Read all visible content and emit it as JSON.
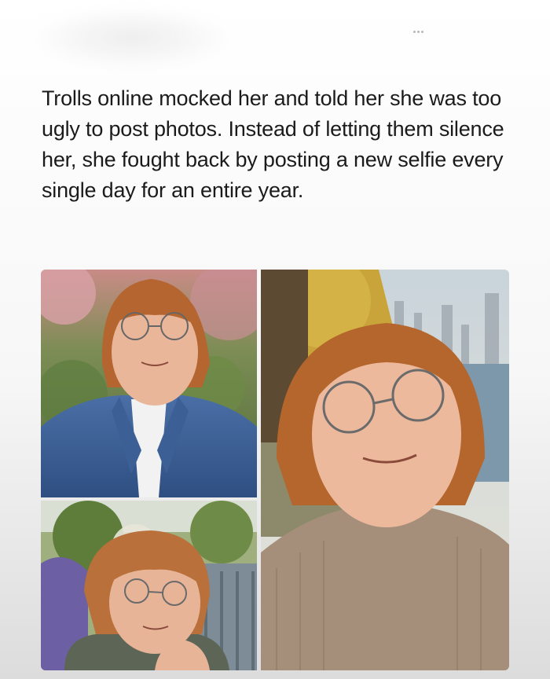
{
  "post": {
    "text": "Trolls online mocked her and told her she was too ugly to post photos. Instead of letting them silence her, she fought back by posting a new selfie every single day for an entire year."
  },
  "photos": [
    {
      "icon": "photo-selfie-denim-jacket-park"
    },
    {
      "icon": "photo-selfie-garden-fence"
    },
    {
      "icon": "photo-selfie-sweater-riverside"
    }
  ],
  "colors": {
    "text": "#1b1b1b",
    "hair": "#b5652f",
    "skin": "#eab69a"
  }
}
